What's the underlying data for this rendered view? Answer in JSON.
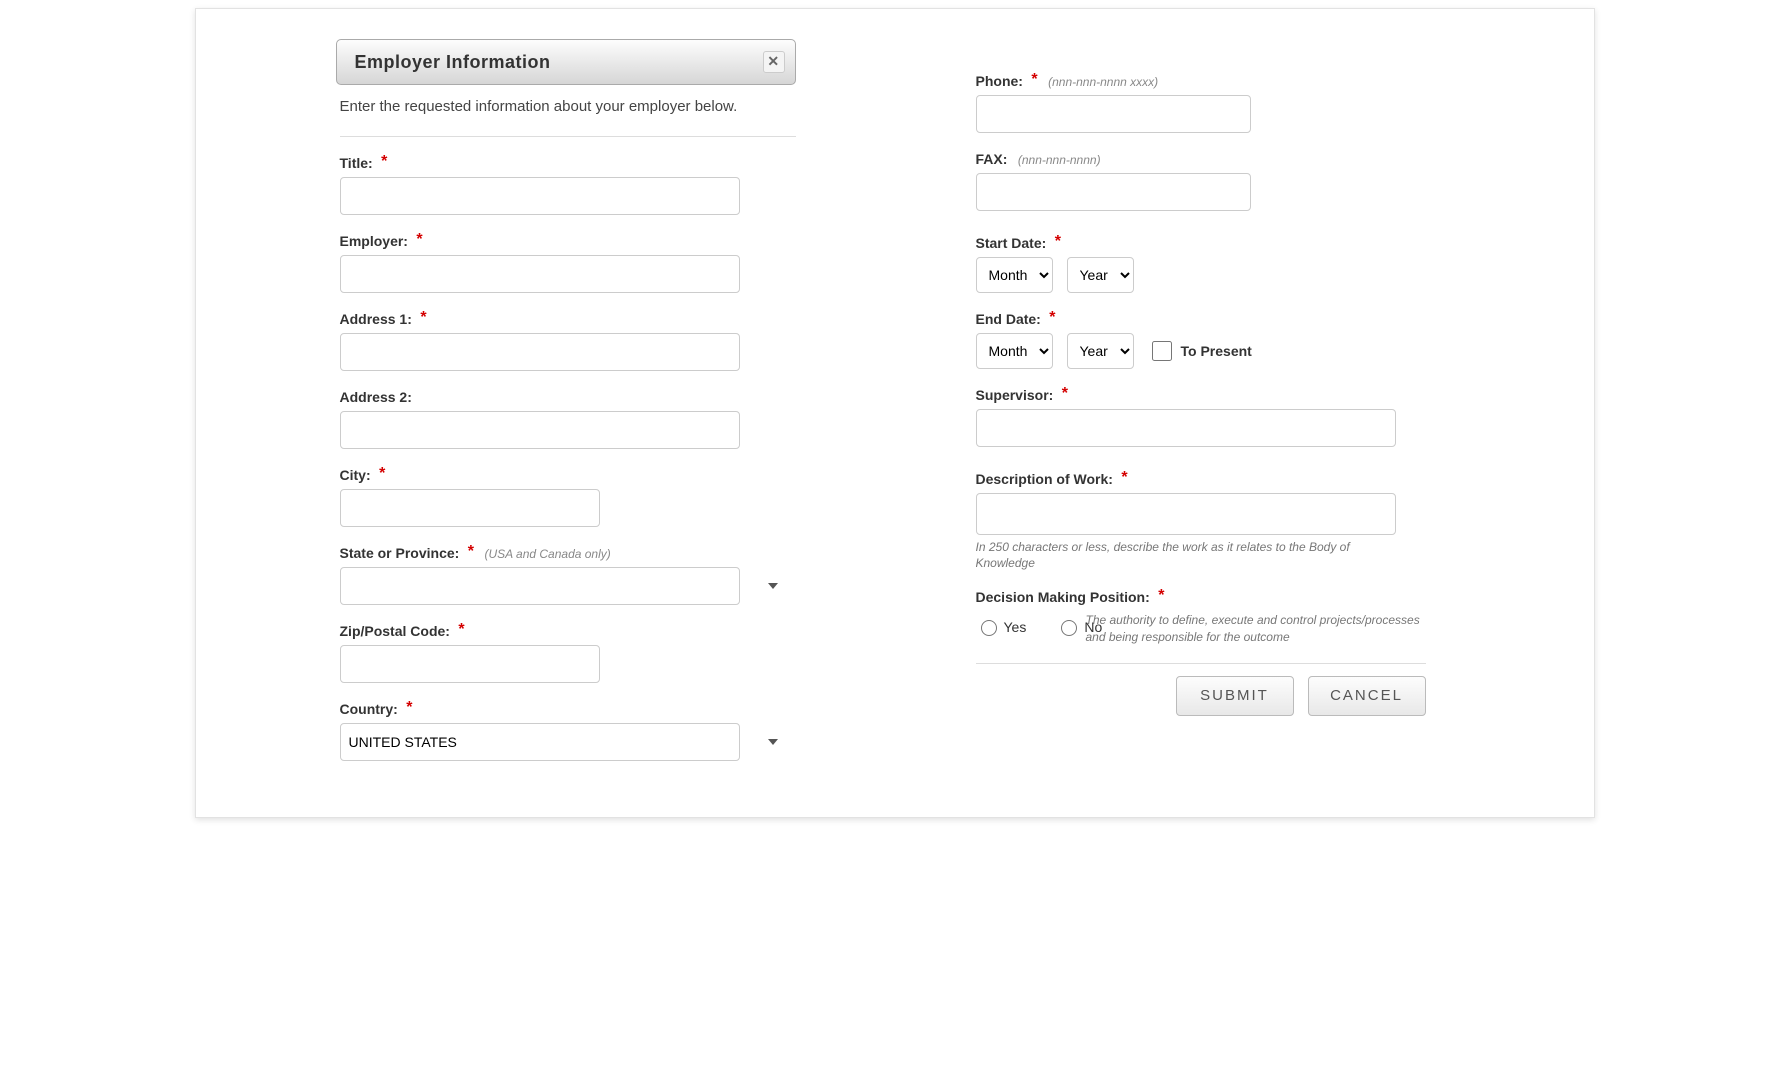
{
  "header": {
    "title": "Employer Information"
  },
  "intro": "Enter the requested information about your employer below.",
  "fields": {
    "title_label": "Title:",
    "employer_label": "Employer:",
    "address1_label": "Address 1:",
    "address2_label": "Address 2:",
    "city_label": "City:",
    "state_label": "State or Province:",
    "state_hint": "(USA and Canada only)",
    "zip_label": "Zip/Postal Code:",
    "country_label": "Country:",
    "country_value": "UNITED STATES",
    "phone_label": "Phone:",
    "phone_hint": "(nnn-nnn-nnnn xxxx)",
    "fax_label": "FAX:",
    "fax_hint": "(nnn-nnn-nnnn)",
    "start_label": "Start Date:",
    "end_label": "End Date:",
    "month_placeholder": "Month",
    "year_placeholder": "Year",
    "to_present_label": "To Present",
    "supervisor_label": "Supervisor:",
    "description_label": "Description of Work:",
    "description_help": "In 250 characters or less, describe the work as it relates to the Body of Knowledge",
    "decision_label": "Decision Making Position:",
    "decision_yes": "Yes",
    "decision_no": "No",
    "decision_help": "The authority to define, execute and control projects/processes and being responsible for the outcome"
  },
  "buttons": {
    "submit": "SUBMIT",
    "cancel": "CANCEL"
  }
}
